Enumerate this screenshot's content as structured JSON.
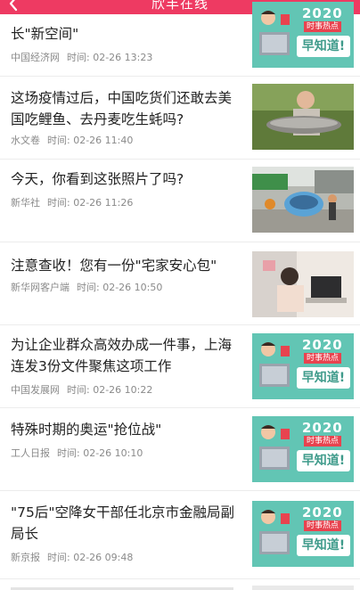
{
  "header": {
    "title": "欣丰在线"
  },
  "feed": [
    {
      "title": "长\"新空间\"",
      "source": "中国经济网",
      "time_label": "时间:",
      "time": "02-26 13:23",
      "thumb": "promo",
      "promo": {
        "year": "2020",
        "hot": "时事热点",
        "know": "早知道!"
      }
    },
    {
      "title": "这场疫情过后，中国吃货们还敢去美国吃鲤鱼、去丹麦吃生蚝吗?",
      "source": "水文卷",
      "time_label": "时间:",
      "time": "02-26 11:40",
      "thumb": "fish-photo"
    },
    {
      "title": "今天，你看到这张照片了吗?",
      "source": "新华社",
      "time_label": "时间:",
      "time": "02-26 11:26",
      "thumb": "street-photo"
    },
    {
      "title": "注意查收！您有一份\"宅家安心包\"",
      "source": "新华网客户端",
      "time_label": "时间:",
      "time": "02-26 10:50",
      "thumb": "desk-photo"
    },
    {
      "title": "为让企业群众高效办成一件事，上海连发3份文件聚焦这项工作",
      "source": "中国发展网",
      "time_label": "时间:",
      "time": "02-26 10:22",
      "thumb": "promo",
      "promo": {
        "year": "2020",
        "hot": "时事热点",
        "know": "早知道!"
      }
    },
    {
      "title": "特殊时期的奥运\"抢位战\"",
      "source": "工人日报",
      "time_label": "时间:",
      "time": "02-26 10:10",
      "thumb": "promo",
      "promo": {
        "year": "2020",
        "hot": "时事热点",
        "know": "早知道!"
      }
    },
    {
      "title": "\"75后\"空降女干部任北京市金融局副局长",
      "source": "新京报",
      "time_label": "时间:",
      "time": "02-26 09:48",
      "thumb": "promo",
      "promo": {
        "year": "2020",
        "hot": "时事热点",
        "know": "早知道!"
      }
    }
  ],
  "colors": {
    "accent": "#ee3a62",
    "promo_bg": "#62c5b4"
  },
  "icons": {
    "back": "chevron-left-icon"
  }
}
